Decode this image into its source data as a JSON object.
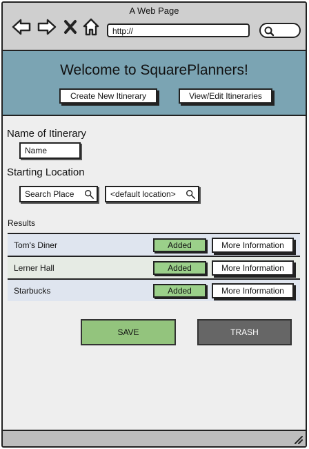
{
  "browser": {
    "title": "A Web Page",
    "url": "http://"
  },
  "header": {
    "welcome": "Welcome to SquarePlanners!",
    "create_label": "Create New Itinerary",
    "view_label": "View/Edit Itineraries"
  },
  "form": {
    "name_label": "Name of Itinerary",
    "name_value": "Name",
    "start_label": "Starting Location",
    "search_place": "Search Place",
    "default_location": "<default location>"
  },
  "results": {
    "label": "Results",
    "rows": [
      {
        "name": "Tom's Diner",
        "status": "Added",
        "info": "More Information"
      },
      {
        "name": "Lerner Hall",
        "status": "Added",
        "info": "More Information"
      },
      {
        "name": "Starbucks",
        "status": "Added",
        "info": "More Information"
      }
    ]
  },
  "actions": {
    "save": "SAVE",
    "trash": "TRASH"
  },
  "colors": {
    "header_bg": "#7ba4b3",
    "added_green": "#9bd08a",
    "save_green": "#93c47d",
    "trash_gray": "#666666"
  }
}
